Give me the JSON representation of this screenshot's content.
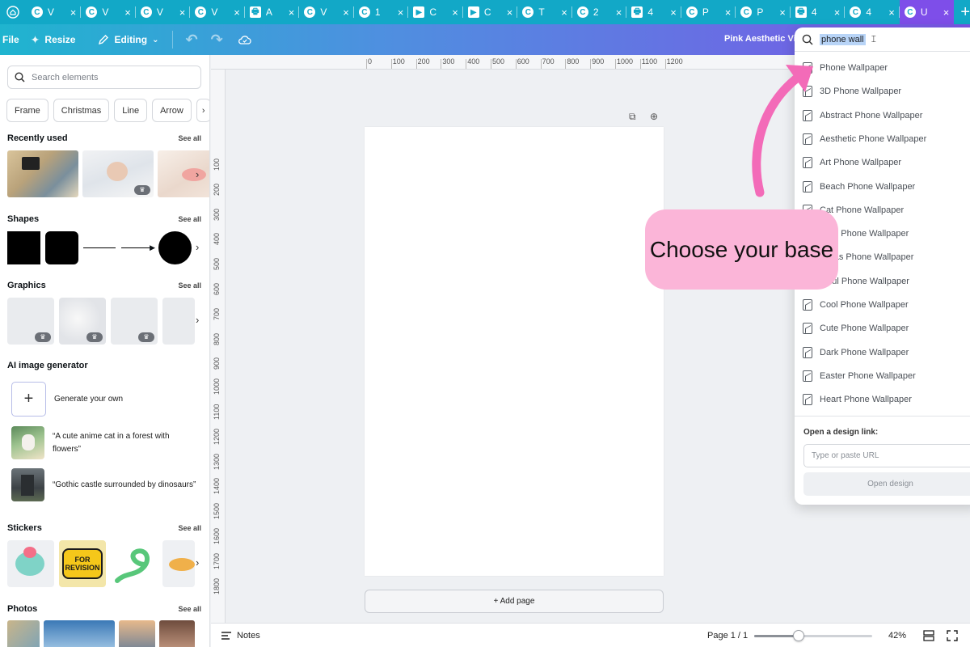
{
  "browser": {
    "tabs": [
      {
        "icon": "C",
        "label": "V"
      },
      {
        "icon": "C",
        "label": "V"
      },
      {
        "icon": "C",
        "label": "V"
      },
      {
        "icon": "C",
        "label": "V"
      },
      {
        "icon": "🖶",
        "label": "A"
      },
      {
        "icon": "C",
        "label": "V"
      },
      {
        "icon": "C",
        "label": "1"
      },
      {
        "icon": "▶",
        "label": "C"
      },
      {
        "icon": "▶",
        "label": "C"
      },
      {
        "icon": "C",
        "label": "T"
      },
      {
        "icon": "C",
        "label": "2"
      },
      {
        "icon": "🖶",
        "label": "4"
      },
      {
        "icon": "C",
        "label": "P"
      },
      {
        "icon": "C",
        "label": "P"
      },
      {
        "icon": "🖶",
        "label": "4"
      },
      {
        "icon": "C",
        "label": "4"
      },
      {
        "icon": "C",
        "label": "U",
        "active": true
      }
    ],
    "new_tab": "+"
  },
  "topbar": {
    "file": "File",
    "resize": "Resize",
    "editing": "Editing",
    "doc_title": "Pink Aesthetic Vi"
  },
  "left_panel": {
    "search_placeholder": "Search elements",
    "chips": [
      "Frame",
      "Christmas",
      "Line",
      "Arrow"
    ],
    "recently_used": {
      "title": "Recently used",
      "see_all": "See all"
    },
    "shapes": {
      "title": "Shapes",
      "see_all": "See all"
    },
    "graphics": {
      "title": "Graphics",
      "see_all": "See all"
    },
    "ai": {
      "title": "AI image generator",
      "generate": "Generate your own",
      "prompts": [
        "“A cute anime cat in a forest with flowers”",
        "“Gothic castle surrounded by dinosaurs”"
      ]
    },
    "stickers": {
      "title": "Stickers",
      "see_all": "See all",
      "sticker_text": "FOR REVISION"
    },
    "photos": {
      "title": "Photos",
      "see_all": "See all"
    }
  },
  "canvas": {
    "ruler_top": [
      "0",
      "100",
      "200",
      "300",
      "400",
      "500",
      "600",
      "700",
      "800",
      "900",
      "1000",
      "1100",
      "1200"
    ],
    "ruler_left": [
      "100",
      "200",
      "300",
      "400",
      "500",
      "600",
      "700",
      "800",
      "900",
      "1000",
      "1100",
      "1200",
      "1300",
      "1400",
      "1500",
      "1600",
      "1700",
      "1800"
    ],
    "add_page": "+ Add page"
  },
  "bottombar": {
    "notes": "Notes",
    "page": "Page 1 / 1",
    "zoom": "42%",
    "zoom_fraction": 0.38
  },
  "dropdown": {
    "query": "phone wall",
    "suggestions": [
      "Phone Wallpaper",
      "3D Phone Wallpaper",
      "Abstract Phone Wallpaper",
      "Aesthetic Phone Wallpaper",
      "Art Phone Wallpaper",
      "Beach Phone Wallpaper",
      "Cat Phone Wallpaper",
      "stian Phone Wallpaper",
      "stmas Phone Wallpaper",
      "lorful Phone Wallpaper",
      "Cool Phone Wallpaper",
      "Cute Phone Wallpaper",
      "Dark Phone Wallpaper",
      "Easter Phone Wallpaper",
      "Heart Phone Wallpaper"
    ],
    "link_label": "Open a design link:",
    "url_placeholder": "Type or paste URL",
    "open_button": "Open design"
  },
  "callout": {
    "text": "Choose your base",
    "color": "#fbb5d8"
  },
  "colors": {
    "tab_strip": "#12a8c7",
    "active_tab": "#7e4ee9",
    "arrow": "#f36bb8"
  }
}
